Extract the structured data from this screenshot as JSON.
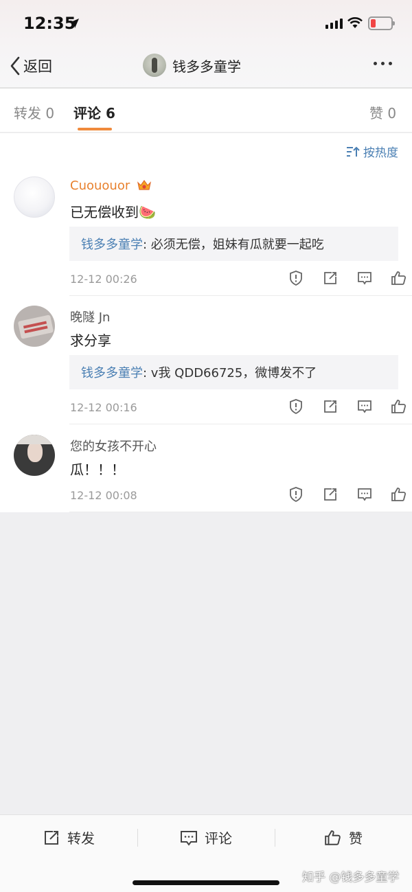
{
  "status_bar": {
    "time": "12:35"
  },
  "nav": {
    "back_label": "返回",
    "title": "钱多多童学"
  },
  "tabs": [
    {
      "label": "转发 0"
    },
    {
      "label": "评论 6"
    },
    {
      "label": "赞 0"
    }
  ],
  "sort": {
    "label": "按热度"
  },
  "comments": [
    {
      "username": "Cuououor",
      "text": "已无偿收到🍉",
      "reply_name": "钱多多童学",
      "reply_text": ": 必须无偿，姐妹有瓜就要一起吃",
      "time": "12-12 00:26"
    },
    {
      "username": "晚隧 Jn",
      "text": "求分享",
      "reply_name": "钱多多童学",
      "reply_text": ": v我 QDD66725，微博发不了",
      "time": "12-12 00:16"
    },
    {
      "username": "您的女孩不开心",
      "text": "瓜！！！",
      "time": "12-12 00:08"
    }
  ],
  "bottom_bar": {
    "repost": "转发",
    "comment": "评论",
    "like": "赞"
  },
  "watermark": "知乎 @钱多多童学",
  "colors": {
    "accent_orange": "#f08a3c",
    "link_blue": "#4a7fb3",
    "username_orange": "#e8812e",
    "battery_red": "#f04545"
  }
}
